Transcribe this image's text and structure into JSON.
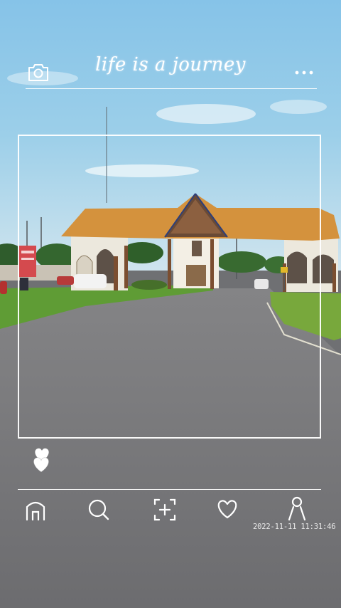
{
  "header": {
    "title": "life is a journey",
    "camera_icon": "camera-icon",
    "more_icon": "more-horizontal-icon"
  },
  "photo": {
    "subject": "entrance-gate-photo",
    "timestamp": "2022-11-11 11:31:46"
  },
  "like": {
    "icon": "double-heart-icon"
  },
  "nav": {
    "items": [
      {
        "id": "home",
        "icon": "home-icon"
      },
      {
        "id": "search",
        "icon": "search-icon"
      },
      {
        "id": "add",
        "icon": "add-frame-icon"
      },
      {
        "id": "likes",
        "icon": "heart-icon"
      },
      {
        "id": "profile",
        "icon": "user-icon"
      }
    ]
  },
  "colors": {
    "sky": "#7fc1e6",
    "roof": "#d5913a",
    "grass": "#6fa53a",
    "road": "#6f7073",
    "overlay_line": "#ffffff"
  }
}
